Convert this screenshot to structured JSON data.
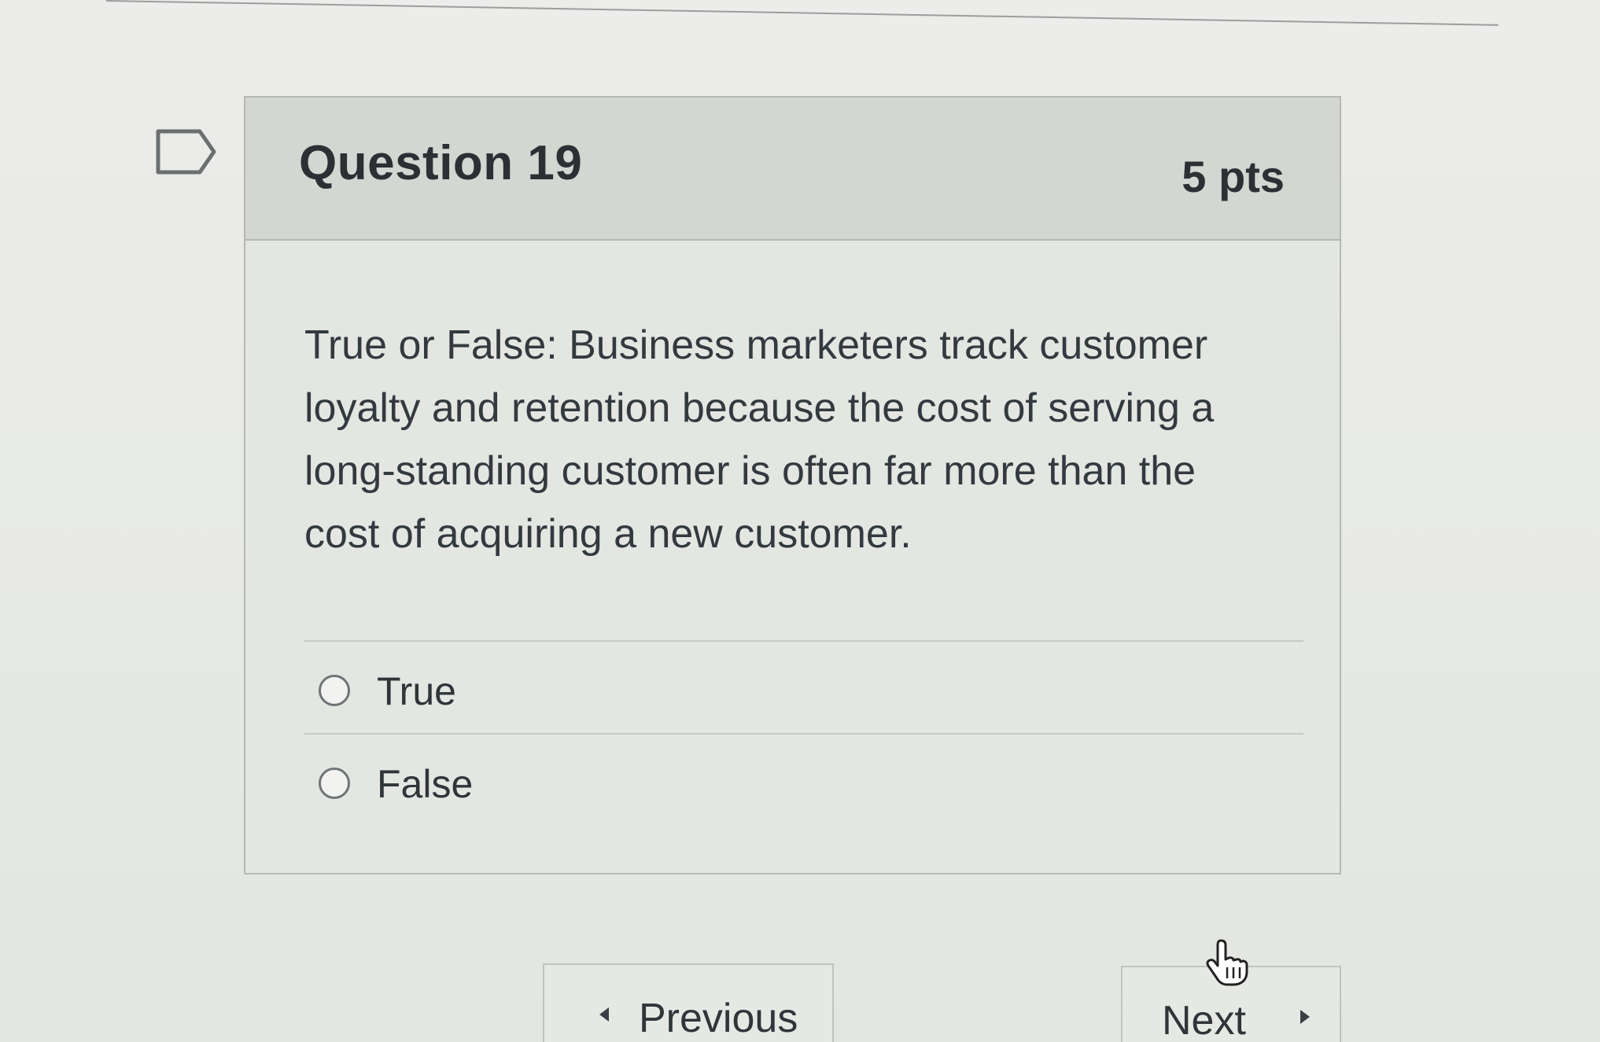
{
  "question": {
    "title": "Question 19",
    "points": "5 pts",
    "text": "True or False: Business marketers track customer loyalty and retention because the cost of serving a long-standing customer is often far more than the cost of acquiring a new customer.",
    "answers": [
      {
        "label": "True",
        "selected": false
      },
      {
        "label": "False",
        "selected": false
      }
    ]
  },
  "navigation": {
    "previous_label": "Previous",
    "next_label": "Next"
  },
  "icons": {
    "flag": "flag-icon",
    "radio": "radio-icon",
    "previous_arrow": "caret-left-icon",
    "next_arrow": "caret-right-icon",
    "cursor": "hand-pointer-icon"
  }
}
